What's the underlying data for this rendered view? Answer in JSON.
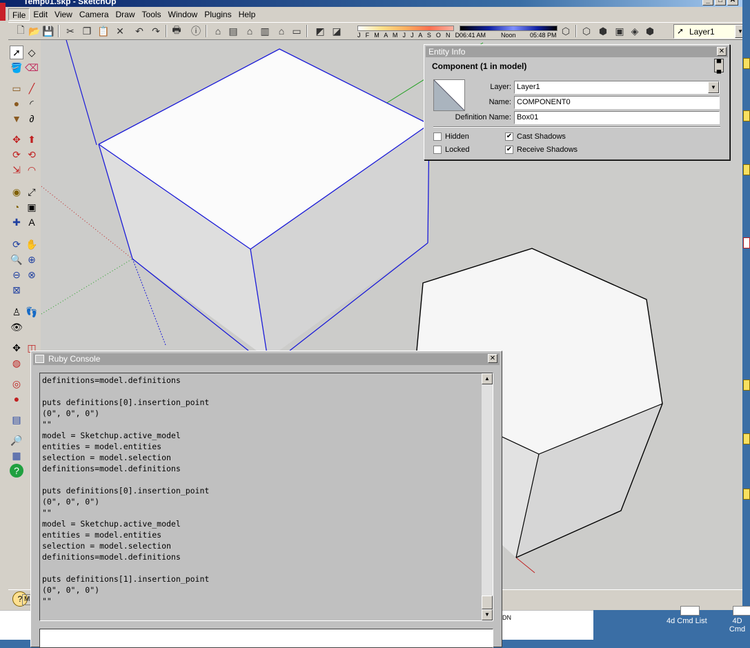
{
  "window": {
    "title": "Temp01.skp - SketchUp",
    "min": "_",
    "max": "□",
    "close": "✕"
  },
  "menu": [
    "File",
    "Edit",
    "View",
    "Camera",
    "Draw",
    "Tools",
    "Window",
    "Plugins",
    "Help"
  ],
  "toolbar": {
    "months": "J F M A M J J A S O N D",
    "time_start": "06:41 AM",
    "time_noon": "Noon",
    "time_end": "05:48 PM",
    "layer_selected": "Layer1",
    "icons": [
      "new-icon",
      "open-icon",
      "save-icon",
      "cut-icon",
      "copy-icon",
      "paste-icon",
      "erase-icon",
      "undo-icon",
      "redo-icon",
      "print-icon",
      "model-info-icon",
      "iso-view-icon",
      "top-view-icon",
      "front-view-icon",
      "right-view-icon",
      "back-view-icon",
      "left-view-icon",
      "xray-icon",
      "back-edges-icon",
      "wireframe-icon",
      "hidden-line-icon",
      "shaded-icon",
      "shaded-textures-icon",
      "monochrome-icon"
    ]
  },
  "entity_info": {
    "panel_title": "Entity Info",
    "heading": "Component (1 in model)",
    "layer_label": "Layer:",
    "layer_value": "Layer1",
    "name_label": "Name:",
    "name_value": "COMPONENT0",
    "defname_label": "Definition Name:",
    "defname_value": "Box01",
    "hidden_label": "Hidden",
    "locked_label": "Locked",
    "cast_shadows_label": "Cast Shadows",
    "receive_shadows_label": "Receive Shadows",
    "hidden_checked": false,
    "locked_checked": false,
    "cast_shadows_checked": true,
    "receive_shadows_checked": true
  },
  "ruby_console": {
    "title": "Ruby Console",
    "output": "definitions=model.definitions\n\nputs definitions[0].insertion_point\n(0\", 0\", 0\")\n\"\"\nmodel = Sketchup.active_model\nentities = model.entities\nselection = model.selection\ndefinitions=model.definitions\n\nputs definitions[0].insertion_point\n(0\", 0\", 0\")\n\"\"\nmodel = Sketchup.active_model\nentities = model.entities\nselection = model.selection\ndefinitions=model.definitions\n\nputs definitions[1].insertion_point\n(0\", 0\", 0\")\n\"\"",
    "input": ""
  },
  "status": {
    "measure_label": "M",
    "help_icon": "?",
    "bottom_fragment": "DN"
  },
  "desktop": {
    "items": [
      "4d Cmd List",
      "4D Cmd"
    ]
  }
}
